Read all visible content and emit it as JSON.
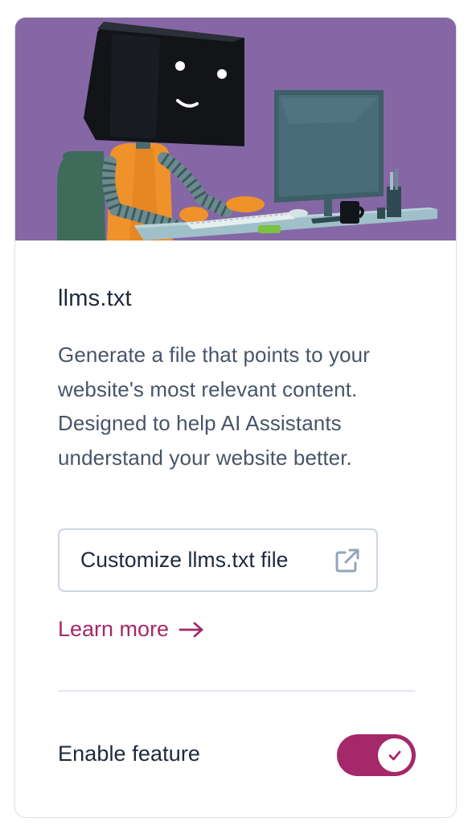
{
  "card": {
    "title": "llms.txt",
    "description": "Generate a file that points to your website's most relevant content. Designed to help AI Assistants understand your website better.",
    "customize_button_label": "Customize llms.txt file",
    "learn_more_label": "Learn more",
    "enable_label": "Enable feature",
    "toggle_state": "on"
  },
  "icons": {
    "customize_button": "external-link-icon",
    "learn_more": "arrow-right-icon",
    "toggle": "check-icon"
  },
  "colors": {
    "hero_background": "#8667a6",
    "accent": "#a4286a",
    "button_border": "#cbd5e1",
    "title_text": "#1e293b",
    "body_text": "#475569"
  }
}
